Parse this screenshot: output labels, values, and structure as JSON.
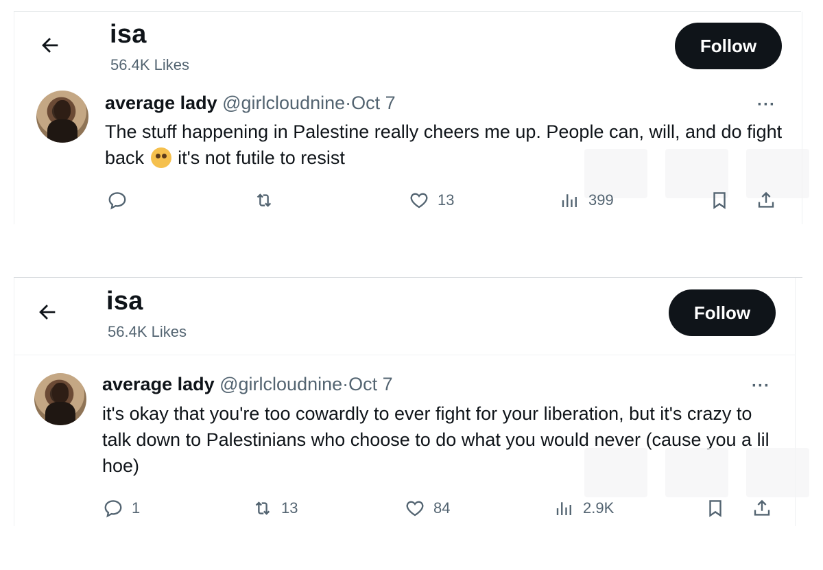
{
  "screens": [
    {
      "profile": {
        "name": "isa",
        "likes": "56.4K Likes",
        "follow_label": "Follow"
      },
      "tweet": {
        "display_name": "average lady",
        "handle": "@girlcloudnine",
        "separator": "·",
        "date": "Oct 7",
        "more_label": "···",
        "text_before_emoji": "The stuff happening in Palestine really cheers me up. People can, will, and do fight back",
        "emoji": "face-holding-back-tears",
        "text_after_emoji": " it's not futile to resist",
        "replies": "",
        "retweets": "",
        "likes": "13",
        "views": "399"
      }
    },
    {
      "profile": {
        "name": "isa",
        "likes": "56.4K Likes",
        "follow_label": "Follow"
      },
      "tweet": {
        "display_name": "average lady",
        "handle": "@girlcloudnine",
        "separator": "·",
        "date": "Oct 7",
        "more_label": "···",
        "text": "it's okay that you're too cowardly to ever fight for your liberation, but it's crazy to talk down to Palestinians who choose to do what you would never (cause you a lil hoe)",
        "replies": "1",
        "retweets": "13",
        "likes": "84",
        "views": "2.9K"
      }
    }
  ],
  "icons": {
    "back": "arrow-left-icon",
    "reply": "speech-bubble-icon",
    "retweet": "retweet-icon",
    "like": "heart-icon",
    "views": "bar-chart-icon",
    "bookmark": "bookmark-icon",
    "share": "share-upload-icon"
  },
  "colors": {
    "text": "#0f1419",
    "muted": "#536471",
    "button": "#0f1419"
  }
}
